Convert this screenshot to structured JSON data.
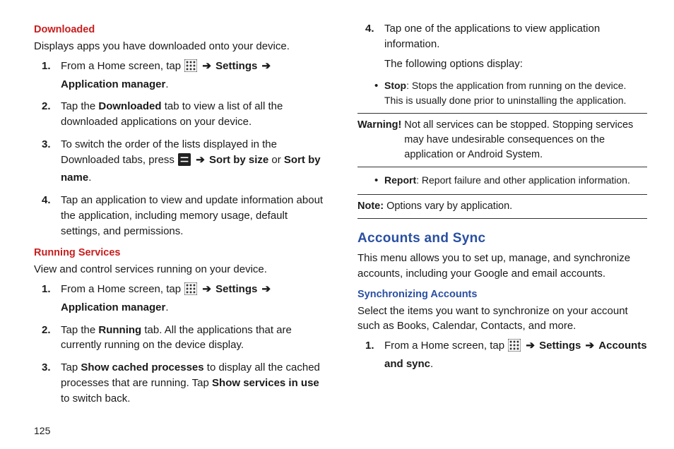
{
  "left": {
    "h_downloaded": "Downloaded",
    "downloaded_intro": "Displays apps you have downloaded onto your device.",
    "steps_dl": {
      "s1_a": "From a Home screen, tap ",
      "s1_b": " Settings",
      "s1_c": "Application manager",
      "s2_a": "Tap the ",
      "s2_b": "Downloaded",
      "s2_c": " tab to view a list of all the downloaded applications on your device.",
      "s3_a": "To switch the order of the lists displayed in the Downloaded tabs, press ",
      "s3_b": " Sort by size",
      "s3_c": " or ",
      "s3_d": "Sort by name",
      "s4": "Tap an application to view and update information about the application, including memory usage, default settings, and permissions."
    },
    "h_running": "Running Services",
    "running_intro": "View and control services running on your device.",
    "steps_run": {
      "s1_a": "From a Home screen, tap ",
      "s1_b": " Settings",
      "s1_c": "Application manager",
      "s2_a": "Tap the ",
      "s2_b": "Running",
      "s2_c": " tab. All the applications that are currently running on the device display.",
      "s3_a": "Tap ",
      "s3_b": "Show cached processes",
      "s3_c": " to display all the cached processes that are running. Tap ",
      "s3_d": "Show services in use",
      "s3_e": " to switch back."
    }
  },
  "right": {
    "step4_a": "Tap one of the applications to view application information.",
    "step4_b": "The following options display:",
    "bullet_stop_lbl": "Stop",
    "bullet_stop_txt": ": Stops the application from running on the device. This is usually done prior to uninstalling the application.",
    "warn_lbl": "Warning!",
    "warn_txt": " Not all services can be stopped. Stopping services may have undesirable consequences on the application or Android System.",
    "bullet_report_lbl": "Report",
    "bullet_report_txt": ": Report failure and other application information.",
    "note_lbl": "Note:",
    "note_txt": " Options vary by application.",
    "h_accounts": "Accounts and Sync",
    "accounts_intro": "This menu allows you to set up, manage, and synchronize accounts, including your Google and email accounts.",
    "h_sync": "Synchronizing Accounts",
    "sync_intro": "Select the items you want to synchronize on your account such as Books, Calendar, Contacts, and more.",
    "steps_sync": {
      "s1_a": "From a Home screen, tap ",
      "s1_b": " Settings",
      "s1_c": " Accounts and sync"
    }
  },
  "page_number": "125",
  "glyphs": {
    "arrow": "➔",
    "bullet": "•",
    "period": "."
  }
}
